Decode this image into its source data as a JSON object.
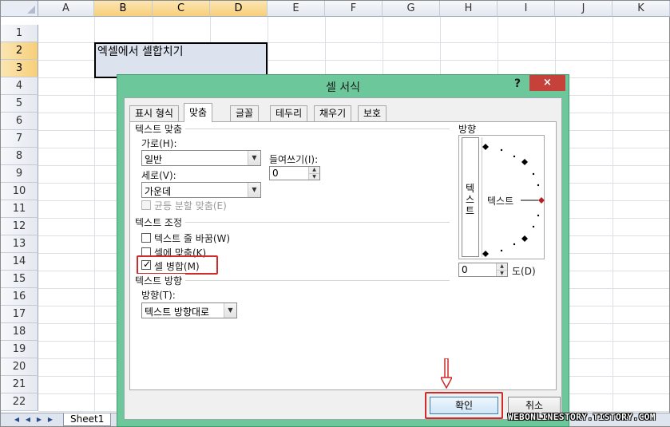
{
  "spreadsheet": {
    "columns": [
      "A",
      "B",
      "C",
      "D",
      "E",
      "F",
      "G",
      "H",
      "I",
      "J",
      "K"
    ],
    "selected_columns": [
      "B",
      "C",
      "D"
    ],
    "rows": [
      "1",
      "2",
      "3",
      "4",
      "5",
      "6",
      "7",
      "8",
      "9",
      "10",
      "11",
      "12",
      "13",
      "14",
      "15",
      "16",
      "17",
      "18",
      "19",
      "20",
      "21",
      "22"
    ],
    "selected_rows": [
      "2",
      "3"
    ],
    "cell_b2_text": "엑셀에서 셀합치기",
    "sheet_tab": "Sheet1"
  },
  "dialog": {
    "title": "셀 서식",
    "help": "?",
    "close": "×",
    "tabs": [
      "표시 형식",
      "맞춤",
      "글꼴",
      "테두리",
      "채우기",
      "보호"
    ],
    "active_tab": "맞춤",
    "text_alignment": {
      "group_label": "텍스트 맞춤",
      "horizontal_label": "가로(H):",
      "horizontal_value": "일반",
      "vertical_label": "세로(V):",
      "vertical_value": "가운데",
      "indent_label": "들여쓰기(I):",
      "indent_value": "0",
      "justify_distributed_label": "균등 분할 맞춤(E)"
    },
    "text_control": {
      "group_label": "텍스트 조정",
      "wrap_text_label": "텍스트 줄 바꿈(W)",
      "wrap_text_checked": false,
      "shrink_to_fit_label": "셀에 맞춤(K)",
      "shrink_to_fit_checked": false,
      "merge_cells_label": "셀 병합(M)",
      "merge_cells_checked": true
    },
    "text_direction": {
      "group_label": "텍스트 방향",
      "direction_label": "방향(T):",
      "direction_value": "텍스트 방향대로"
    },
    "orientation": {
      "group_label": "방향",
      "vertical_text": [
        "텍",
        "스",
        "트"
      ],
      "dial_text": "텍스트",
      "degrees_value": "0",
      "degrees_label": "도(D)"
    },
    "ok_label": "확인",
    "cancel_label": "취소"
  },
  "watermark": "WEBONLINESTORY.TISTORY.COM",
  "colors": {
    "dialog_frame": "#6cc79a",
    "close_button": "#c7413b",
    "highlight": "#d02b2b",
    "selected_header": "#f7cf7a"
  }
}
